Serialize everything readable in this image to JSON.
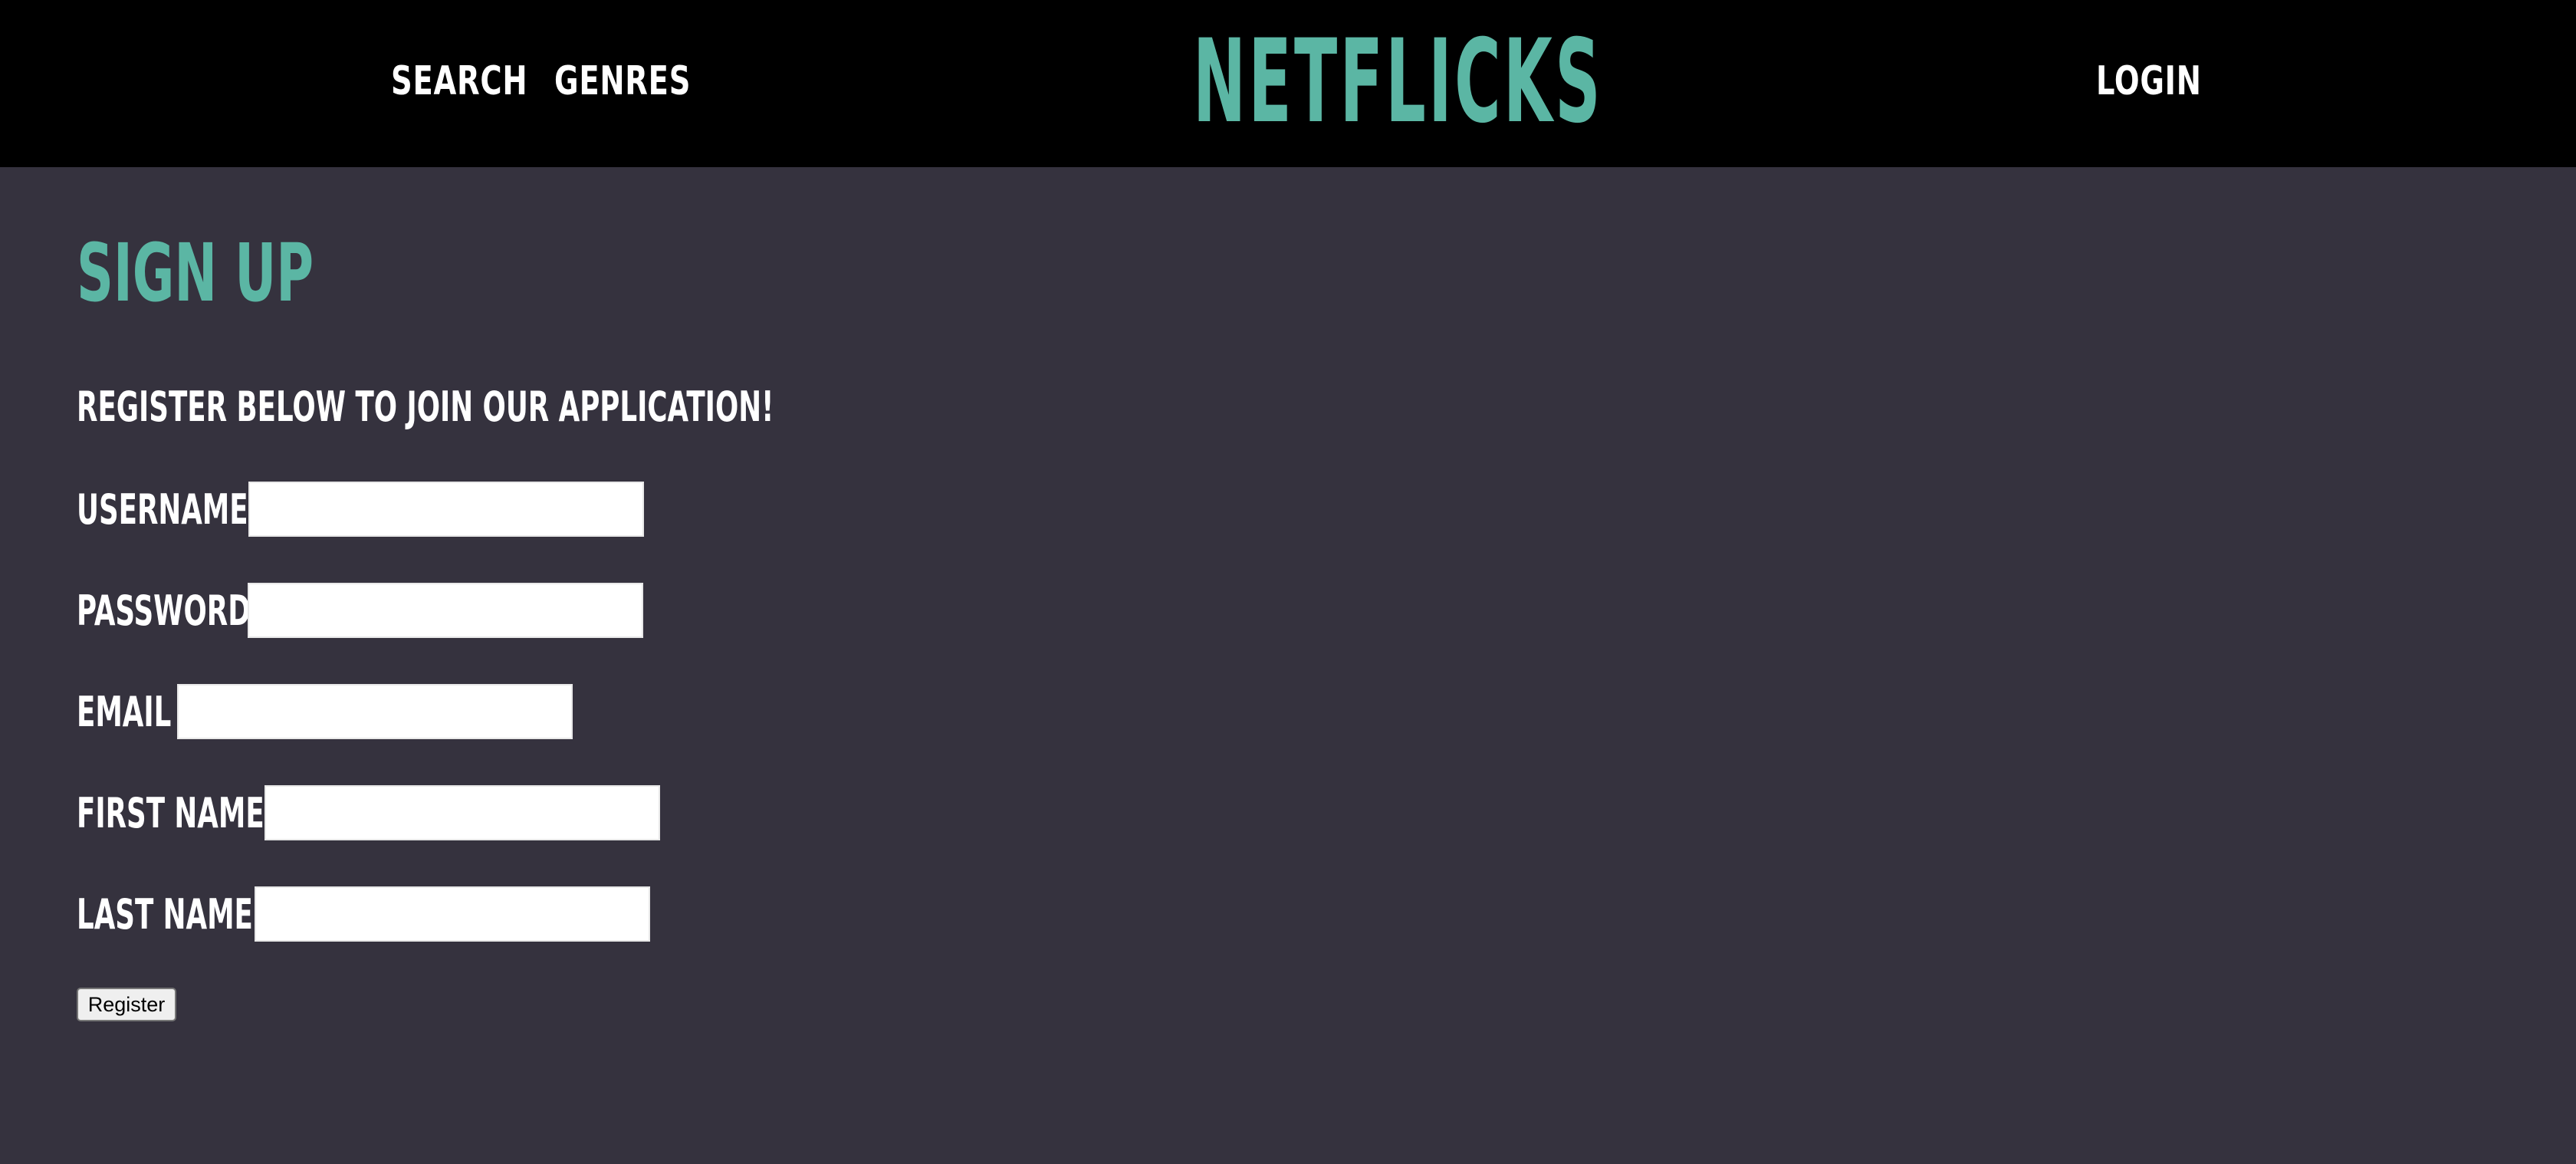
{
  "header": {
    "nav_left": [
      {
        "label": "SEARCH"
      },
      {
        "label": "GENRES"
      }
    ],
    "logo_text": "NETFLICKS",
    "nav_right": [
      {
        "label": "LOGIN"
      }
    ]
  },
  "main": {
    "title": "SIGN UP",
    "subtitle": "REGISTER BELOW TO JOIN OUR APPLICATION!",
    "fields": [
      {
        "label": "USERNAME",
        "value": ""
      },
      {
        "label": "PASSWORD",
        "value": ""
      },
      {
        "label": "EMAIL",
        "value": ""
      },
      {
        "label": "FIRST NAME",
        "value": ""
      },
      {
        "label": "LAST NAME",
        "value": ""
      }
    ],
    "submit_label": "Register"
  },
  "colors": {
    "header_bg": "#000000",
    "page_bg": "#35323e",
    "accent": "#5bb6a4",
    "text": "#ffffff"
  }
}
